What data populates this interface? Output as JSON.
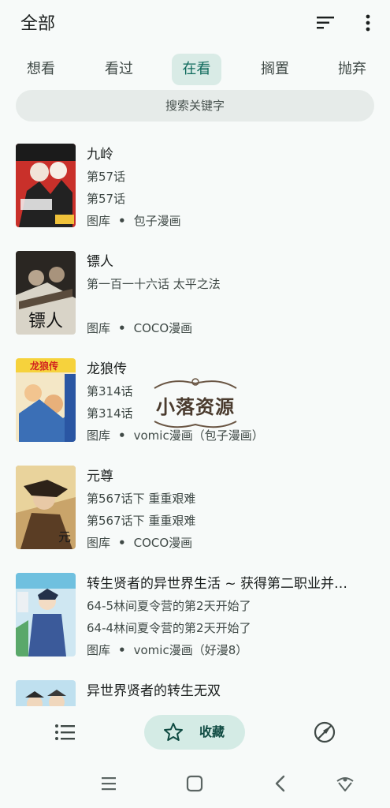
{
  "header": {
    "title": "全部",
    "sort_icon": "sort-icon",
    "more_icon": "more-vert-icon"
  },
  "tabs": [
    {
      "label": "想看",
      "active": false
    },
    {
      "label": "看过",
      "active": false
    },
    {
      "label": "在看",
      "active": true
    },
    {
      "label": "搁置",
      "active": false
    },
    {
      "label": "抛弃",
      "active": false
    }
  ],
  "search": {
    "placeholder": "搜索关键字"
  },
  "comics": [
    {
      "title": "九岭",
      "line1": "第57话",
      "line2": "第57话",
      "library": "图库",
      "source": "包子漫画"
    },
    {
      "title": "镖人",
      "line1": "第一百一十六话 太平之法",
      "line2": "",
      "library": "图库",
      "source": "COCO漫画"
    },
    {
      "title": "龙狼传",
      "line1": "第314话",
      "line2": "第314话",
      "library": "图库",
      "source": "vomic漫画（包子漫画）"
    },
    {
      "title": "元尊",
      "line1": "第567话下 重重艰难",
      "line2": "第567话下 重重艰难",
      "library": "图库",
      "source": "COCO漫画"
    },
    {
      "title": "转生贤者的异世界生活 ~ 获得第二职业并…",
      "line1": "64-5林间夏令营的第2天开始了",
      "line2": "64-4林间夏令营的第2天开始了",
      "library": "图库",
      "source": "vomic漫画（好漫8）"
    },
    {
      "title": "异世界贤者的转生无双",
      "line1": "",
      "line2": "",
      "library": "",
      "source": ""
    }
  ],
  "watermark": {
    "text": "小落资源"
  },
  "bottom_nav": {
    "list_icon": "list-icon",
    "favorites_label": "收藏",
    "favorites_icon": "star-icon",
    "explore_icon": "compass-icon"
  },
  "system_nav": {
    "icons": [
      "menu-icon",
      "home-icon",
      "back-icon",
      "assistant-icon"
    ]
  },
  "colors": {
    "accent": "#0f6a5c",
    "tab_active_bg": "#d9ebe6",
    "fav_bg": "#d4ebe5",
    "background": "#f7faf9"
  }
}
